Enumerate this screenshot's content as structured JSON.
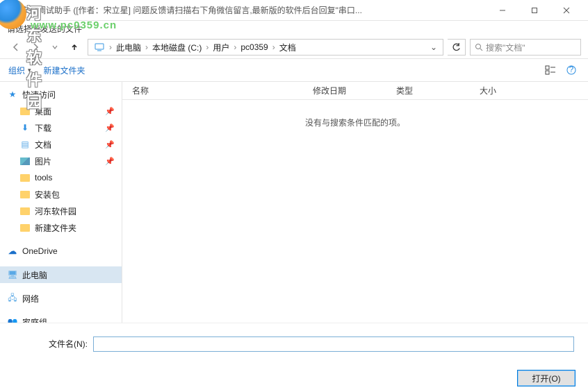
{
  "outer_window": {
    "title": "串口调试助手 ([作者：宋立星] 问题反馈请扫描右下角微信留言,最新版的软件后台回复\"串口..."
  },
  "watermark": {
    "site_name_zh": "河东软件园",
    "url": "www.pc0359.cn"
  },
  "dialog": {
    "title": "请选择要发送的文件"
  },
  "breadcrumb": {
    "root": "此电脑",
    "parts": [
      "本地磁盘 (C:)",
      "用户",
      "pc0359",
      "文档"
    ]
  },
  "search": {
    "placeholder": "搜索\"文档\""
  },
  "toolbar": {
    "organize": "组织",
    "new_folder": "新建文件夹"
  },
  "columns": {
    "name": "名称",
    "date": "修改日期",
    "type": "类型",
    "size": "大小"
  },
  "content": {
    "empty_message": "没有与搜索条件匹配的项。"
  },
  "sidebar": {
    "quick_access": "快速访问",
    "items_pinned": [
      {
        "label": "桌面",
        "icon": "folder"
      },
      {
        "label": "下载",
        "icon": "download"
      },
      {
        "label": "文档",
        "icon": "document"
      },
      {
        "label": "图片",
        "icon": "picture"
      }
    ],
    "items_recent": [
      {
        "label": "tools"
      },
      {
        "label": "安装包"
      },
      {
        "label": "河东软件园"
      },
      {
        "label": "新建文件夹"
      }
    ],
    "onedrive": "OneDrive",
    "this_pc": "此电脑",
    "network": "网络",
    "homegroup": "家庭组"
  },
  "filename": {
    "label": "文件名(N):",
    "value": ""
  },
  "footer": {
    "open": "打开(O)"
  }
}
